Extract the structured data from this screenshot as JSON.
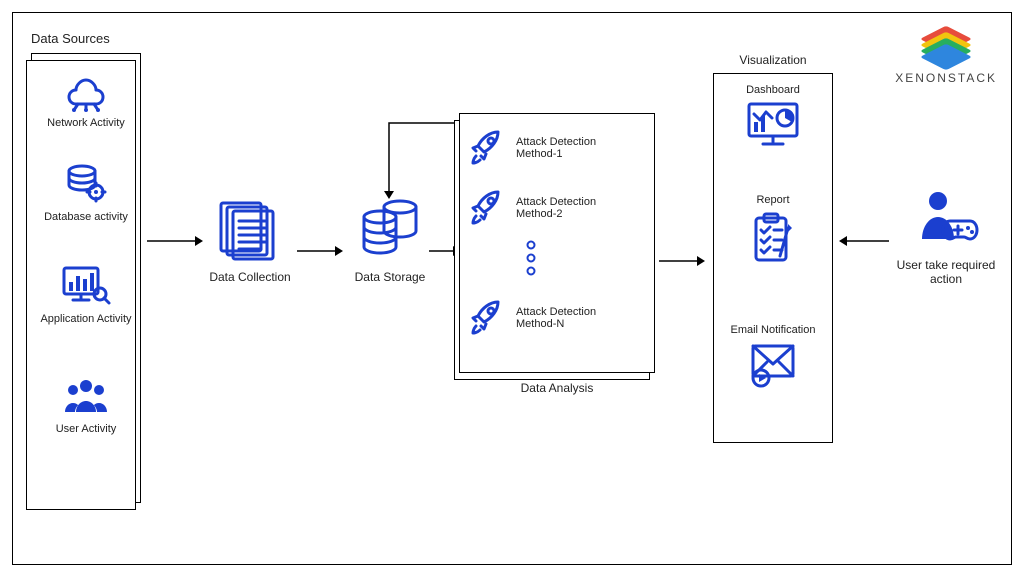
{
  "brand": {
    "name": "XENONSTACK"
  },
  "sections": {
    "data_sources": {
      "title": "Data Sources",
      "items": [
        {
          "label": "Network Activity",
          "icon": "cloud-network-icon"
        },
        {
          "label": "Database activity",
          "icon": "database-gear-icon"
        },
        {
          "label": "Application Activity",
          "icon": "monitor-chart-icon"
        },
        {
          "label": "User Activity",
          "icon": "user-group-icon"
        }
      ]
    },
    "data_collection": {
      "label": "Data Collection",
      "icon": "documents-icon"
    },
    "data_storage": {
      "label": "Data Storage",
      "icon": "database-stack-icon"
    },
    "data_analysis": {
      "title": "Data Analysis",
      "methods": [
        {
          "label": "Attack Detection Method-1",
          "icon": "rocket-icon"
        },
        {
          "label": "Attack Detection Method-2",
          "icon": "rocket-icon"
        },
        {
          "label": "Attack Detection Method-N",
          "icon": "rocket-icon"
        }
      ]
    },
    "visualization": {
      "title": "Visualization",
      "items": [
        {
          "label": "Dashboard",
          "icon": "dashboard-monitor-icon"
        },
        {
          "label": "Report",
          "icon": "clipboard-report-icon"
        },
        {
          "label": "Email Notification",
          "icon": "email-play-icon"
        }
      ]
    },
    "user_action": {
      "label": "User take required action",
      "icon": "user-controller-icon"
    }
  },
  "chart_data": {
    "type": "flow-diagram",
    "nodes": [
      {
        "id": "data_sources",
        "label": "Data Sources",
        "children": [
          "Network Activity",
          "Database activity",
          "Application Activity",
          "User Activity"
        ]
      },
      {
        "id": "data_collection",
        "label": "Data Collection"
      },
      {
        "id": "data_storage",
        "label": "Data Storage"
      },
      {
        "id": "data_analysis",
        "label": "Data Analysis",
        "children": [
          "Attack Detection Method-1",
          "Attack Detection Method-2",
          "Attack Detection Method-N"
        ]
      },
      {
        "id": "visualization",
        "label": "Visualization",
        "children": [
          "Dashboard",
          "Report",
          "Email Notification"
        ]
      },
      {
        "id": "user_action",
        "label": "User take required action"
      }
    ],
    "edges": [
      {
        "from": "data_sources",
        "to": "data_collection"
      },
      {
        "from": "data_collection",
        "to": "data_storage"
      },
      {
        "from": "data_storage",
        "to": "data_analysis"
      },
      {
        "from": "data_analysis",
        "to": "data_storage",
        "kind": "feedback"
      },
      {
        "from": "data_analysis",
        "to": "visualization"
      },
      {
        "from": "user_action",
        "to": "visualization"
      }
    ]
  }
}
